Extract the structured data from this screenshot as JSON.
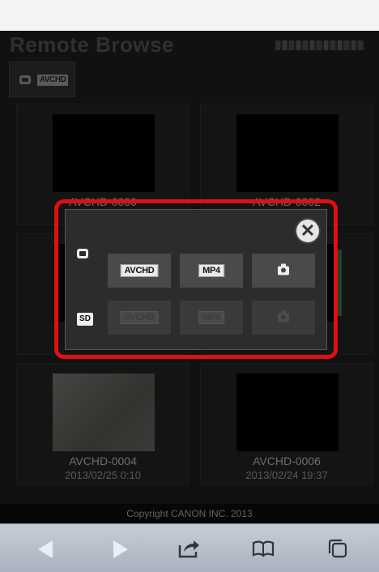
{
  "app": {
    "title": "Remote Browse",
    "media_tab": {
      "format": "AVCHD"
    }
  },
  "clips": [
    {
      "name": "AVCHD-0000",
      "date": ""
    },
    {
      "name": "AVCHD-0002",
      "date": ""
    },
    {
      "name": "",
      "date": ""
    },
    {
      "name": "",
      "date": ""
    },
    {
      "name": "AVCHD-0004",
      "date": "2013/02/25 0:10"
    },
    {
      "name": "AVCHD-0006",
      "date": "2013/02/24 19:37"
    }
  ],
  "modal": {
    "close_symbol": "✕",
    "rows": [
      {
        "source": "internal-memory",
        "buttons": [
          {
            "label": "AVCHD",
            "enabled": true
          },
          {
            "label": "MP4",
            "enabled": true
          },
          {
            "label": "photo",
            "enabled": true
          }
        ]
      },
      {
        "source": "SD",
        "buttons": [
          {
            "label": "AVCHD",
            "enabled": false
          },
          {
            "label": "MP4",
            "enabled": false
          },
          {
            "label": "photo",
            "enabled": false
          }
        ]
      }
    ],
    "highlight_color": "#e01010"
  },
  "footer": {
    "copyright": "Copyright CANON INC. 2013"
  },
  "browser_toolbar": {
    "buttons": [
      "back-icon",
      "forward-icon",
      "share-icon",
      "bookmarks-icon",
      "tabs-icon"
    ]
  }
}
